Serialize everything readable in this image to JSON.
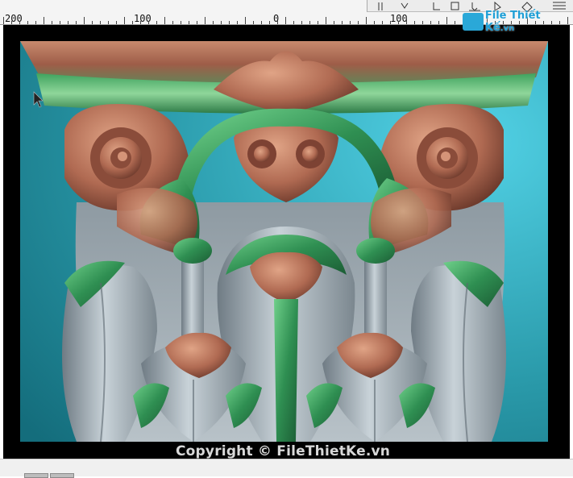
{
  "ruler": {
    "labels": [
      "200",
      "100",
      "0",
      "100"
    ]
  },
  "watermark": {
    "logo_main": "File",
    "logo_second": "Thiết Kế",
    "logo_suffix": ".vn",
    "copyright": "Copyright © FileThietKe.vn"
  },
  "colors": {
    "background_teal": "#2a9aaa",
    "copper": "#b06a52",
    "green": "#3a9a5c",
    "silver": "#9aa6ae"
  },
  "icons": [
    "toolbar-button-icon"
  ]
}
